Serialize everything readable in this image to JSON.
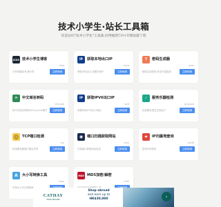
{
  "header": {
    "title": "技术小学生·站长工具箱",
    "subtitle": "欢迎访问\"技术小学生\"工具集,好用推荐Ctrl+D键收藏了吧"
  },
  "cards": [
    {
      "name": "技术小学生博客",
      "meta": "blog",
      "desc": "分享电脑技术,爱分享",
      "button": "立即使用",
      "icon_color": "#1d2733",
      "icon_text": "JSXX"
    },
    {
      "name": "获取本地出口IP",
      "meta": "myip",
      "desc": "获取本地出口,查看本地IP",
      "button": "立即使用",
      "icon_color": "#123f8c",
      "icon_text": "IP"
    },
    {
      "name": "密码生成器",
      "meta": "pass",
      "desc": "随机生成密码,安全可靠易用",
      "button": "立即使用",
      "icon_color": "#f07a55",
      "icon_text": "T"
    },
    {
      "name": "中文域名转码",
      "meta": "idncode",
      "desc": "将中文域名转换为Punycode格式",
      "button": "立即使用",
      "icon_color": "#2e8b57",
      "icon_text": "⟳"
    },
    {
      "name": "获取IPV6出口IP",
      "meta": "ipv6",
      "desc": "查看本地IPV6出口地址",
      "button": "立即使用",
      "icon_color": "#123f8c",
      "icon_text": "IP"
    },
    {
      "name": "服务乐器检测",
      "meta": "pingtool",
      "desc": "检测服务是否正常运行",
      "button": "立即使用",
      "icon_color": "#1aa688",
      "icon_text": "✓"
    },
    {
      "name": "TCP端口检测",
      "meta": "tcp",
      "desc": "检测服务器端口是否开放",
      "button": "立即使用",
      "icon_color": "#f7c948",
      "icon_text": "☺"
    },
    {
      "name": "端口扫描获取网站",
      "meta": "scan",
      "desc": "扫描端口获取网站信息",
      "button": "立即使用",
      "icon_color": "#1a2a4a",
      "icon_text": "◉"
    },
    {
      "name": "IP归属地查询",
      "meta": "ipinfo",
      "desc": "查询IP归属地",
      "button": "立即使用",
      "icon_color": "#e0483e",
      "icon_text": "⌖"
    },
    {
      "name": "大小写转换工具",
      "meta": "case",
      "desc": "字母大小写互相转换",
      "button": "立即使用",
      "icon_color": "#4aa3df",
      "icon_text": "A"
    },
    {
      "name": "MD5加密/解密",
      "meta": "md5",
      "desc": "MD5在线加密解密工具",
      "button": "立即使用",
      "icon_color": "#c0142a",
      "icon_text": "MD5"
    }
  ],
  "ad": {
    "brand": "CATHAY",
    "brand_sub": "MOVE BEYOND",
    "line1": "Shop abroad",
    "line2": "and earn up to",
    "line3": "HK$30,000",
    "cta": "›"
  }
}
